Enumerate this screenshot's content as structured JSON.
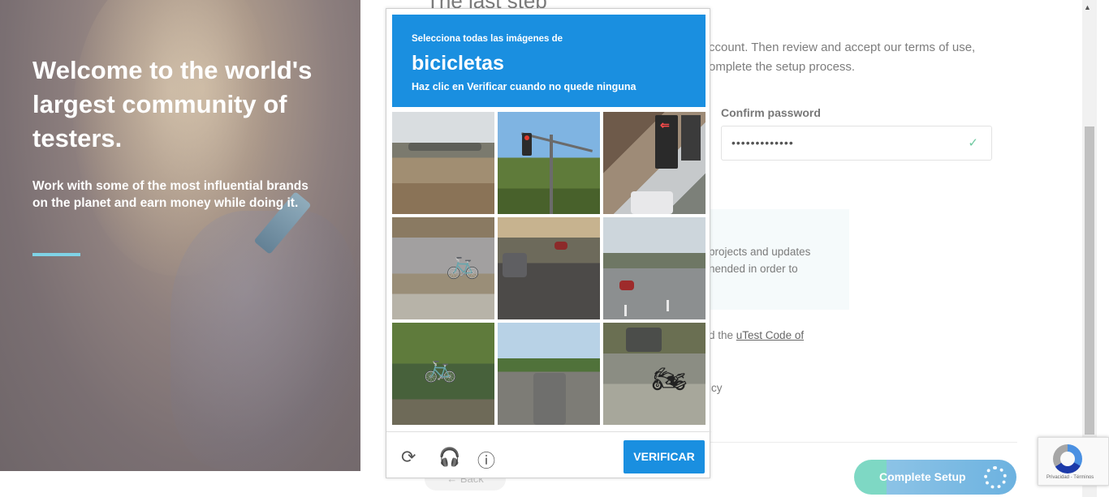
{
  "hero": {
    "title": "Welcome to the world's largest community of testers.",
    "subtitle": "Work with some of the most influential brands on the planet and earn money while doing it."
  },
  "form": {
    "title": "The last step",
    "intro": "ccount. Then review and accept our terms of use, omplete the setup process.",
    "confirm_label": "Confirm password",
    "confirm_value": "•••••••••••••",
    "info_text": "projects and updates nended in order to",
    "code_prefix": "d the ",
    "code_link": "uTest Code of",
    "policy_fragment": "icy",
    "back_label": "Back",
    "complete_label": "Complete Setup"
  },
  "captcha": {
    "instruction": "Selecciona todas las imágenes de",
    "target": "bicicletas",
    "hint": "Haz clic en Verificar cuando no quede ninguna",
    "verify_label": "VERIFICAR",
    "icons": {
      "reload": "reload-icon",
      "audio": "headphones-icon",
      "info": "info-icon"
    }
  },
  "badge": {
    "links": "Privacidad - Términos"
  },
  "colors": {
    "captcha_blue": "#1a8fe0",
    "accent_line": "#7fd3e6",
    "complete_green": "#7ed8c4",
    "complete_blue": "#6cb2e0"
  }
}
